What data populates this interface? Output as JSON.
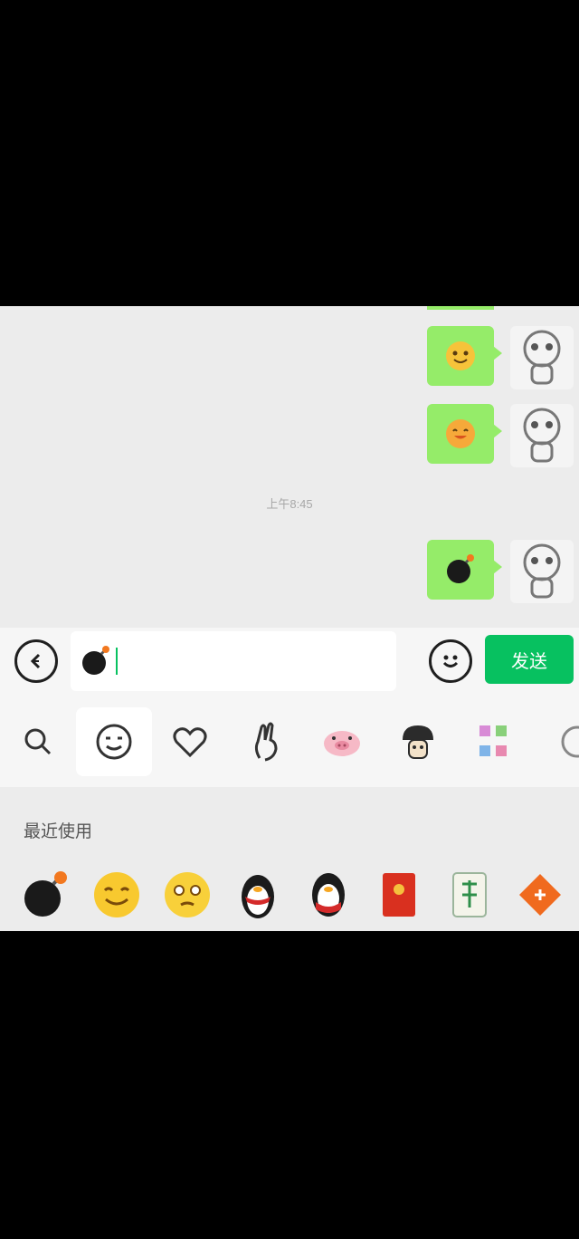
{
  "chat": {
    "timestamp": "上午8:45",
    "messages": [
      {
        "type": "emoji",
        "emoji": "smile-emoji"
      },
      {
        "type": "emoji",
        "emoji": "grin-emoji"
      },
      {
        "type": "emoji",
        "emoji": "bomb-emoji"
      }
    ]
  },
  "input": {
    "draft_emoji": "bomb-emoji",
    "send_label": "发送"
  },
  "emoji_tabs": [
    "search-icon",
    "smiley-icon",
    "heart-icon",
    "gesture-icon",
    "pig-icon",
    "mushroom-icon",
    "sticker-icon",
    "more-icon"
  ],
  "panel": {
    "recent_title": "最近使用",
    "recent": [
      "bomb-emoji",
      "happy-emoji",
      "tearful-emoji",
      "penguin-emoji",
      "penguin-red-emoji",
      "red-packet-emoji",
      "mahjong-emoji",
      "fortune-emoji"
    ]
  },
  "colors": {
    "bubble": "#95ec69",
    "send": "#07c160",
    "background": "#ededed"
  }
}
